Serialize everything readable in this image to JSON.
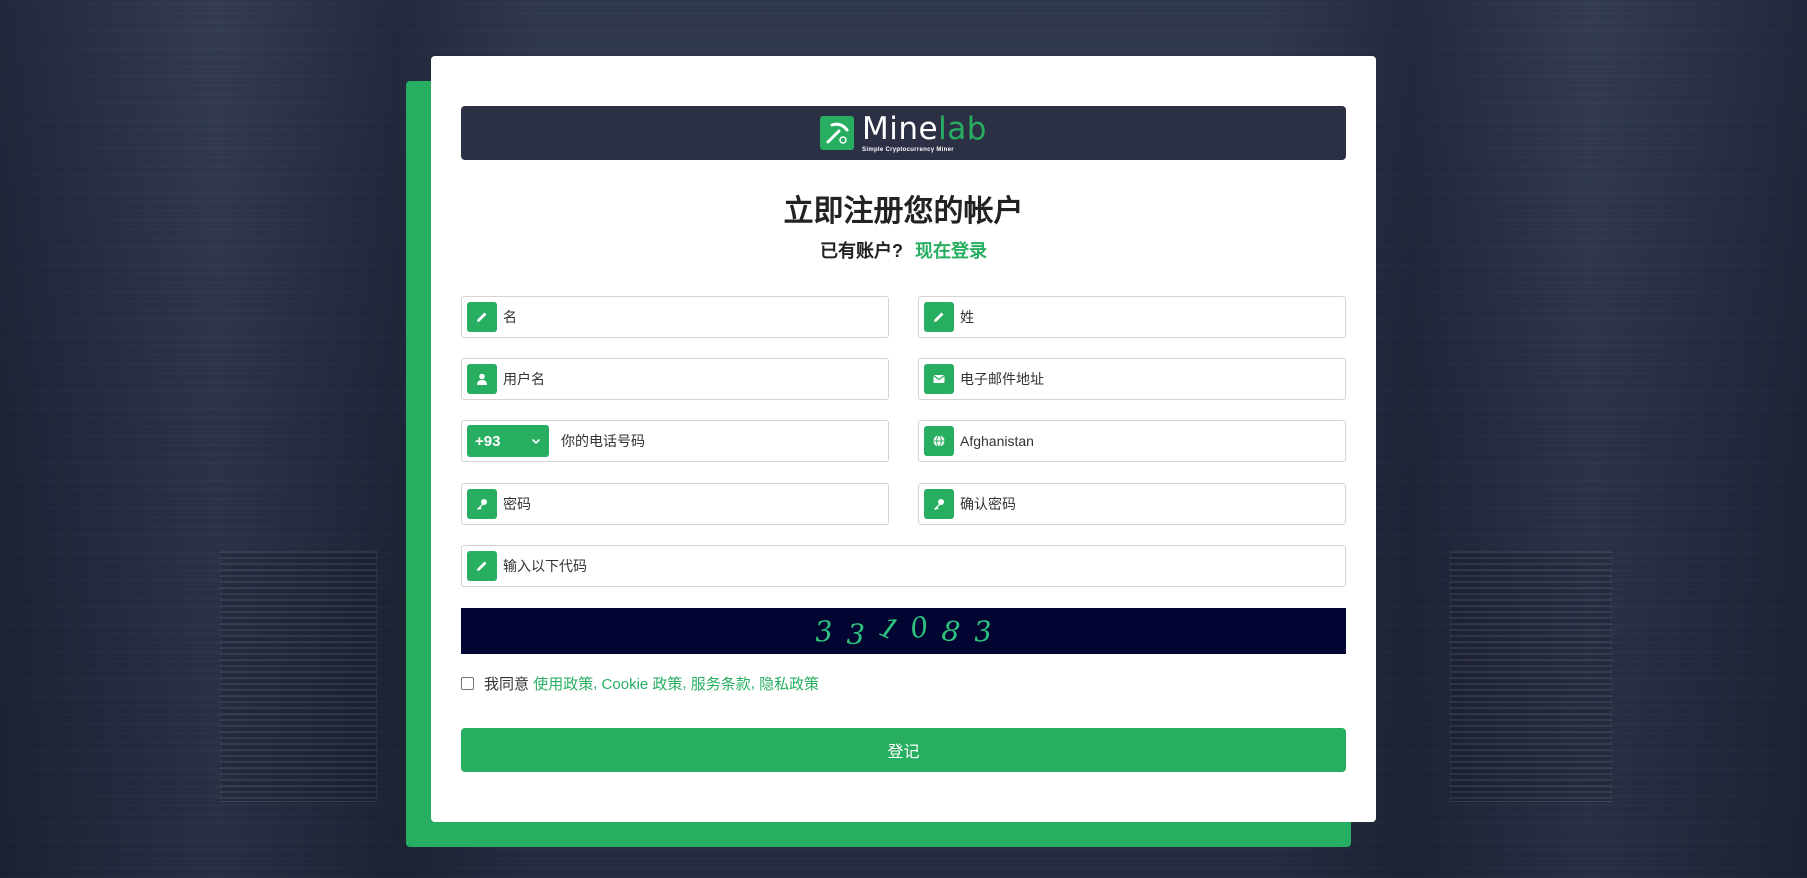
{
  "brand": {
    "name_part1": "Mine",
    "name_part2": "lab",
    "tagline": "Simple Cryptocurrency Miner"
  },
  "heading": {
    "title": "立即注册您的帐户",
    "have_account": "已有账户?",
    "login_link": "现在登录"
  },
  "form": {
    "first_name_placeholder": "名",
    "last_name_placeholder": "姓",
    "username_placeholder": "用户名",
    "email_placeholder": "电子邮件地址",
    "phone_code": "+93",
    "phone_placeholder": "你的电话号码",
    "country_value": "Afghanistan",
    "password_placeholder": "密码",
    "confirm_password_placeholder": "确认密码",
    "captcha_input_placeholder": "输入以下代码",
    "captcha_chars": [
      "3",
      "3",
      "1",
      "0",
      "8",
      "3"
    ]
  },
  "agreement": {
    "prefix": "我同意",
    "usage_policy": "使用政策",
    "cookie_policy": "Cookie 政策",
    "terms": "服务条款",
    "privacy": "隐私政策",
    "separator": ","
  },
  "submit_label": "登记",
  "colors": {
    "accent": "#27ae60",
    "logo_bar": "#2b3045",
    "captcha_bg": "#020431"
  }
}
